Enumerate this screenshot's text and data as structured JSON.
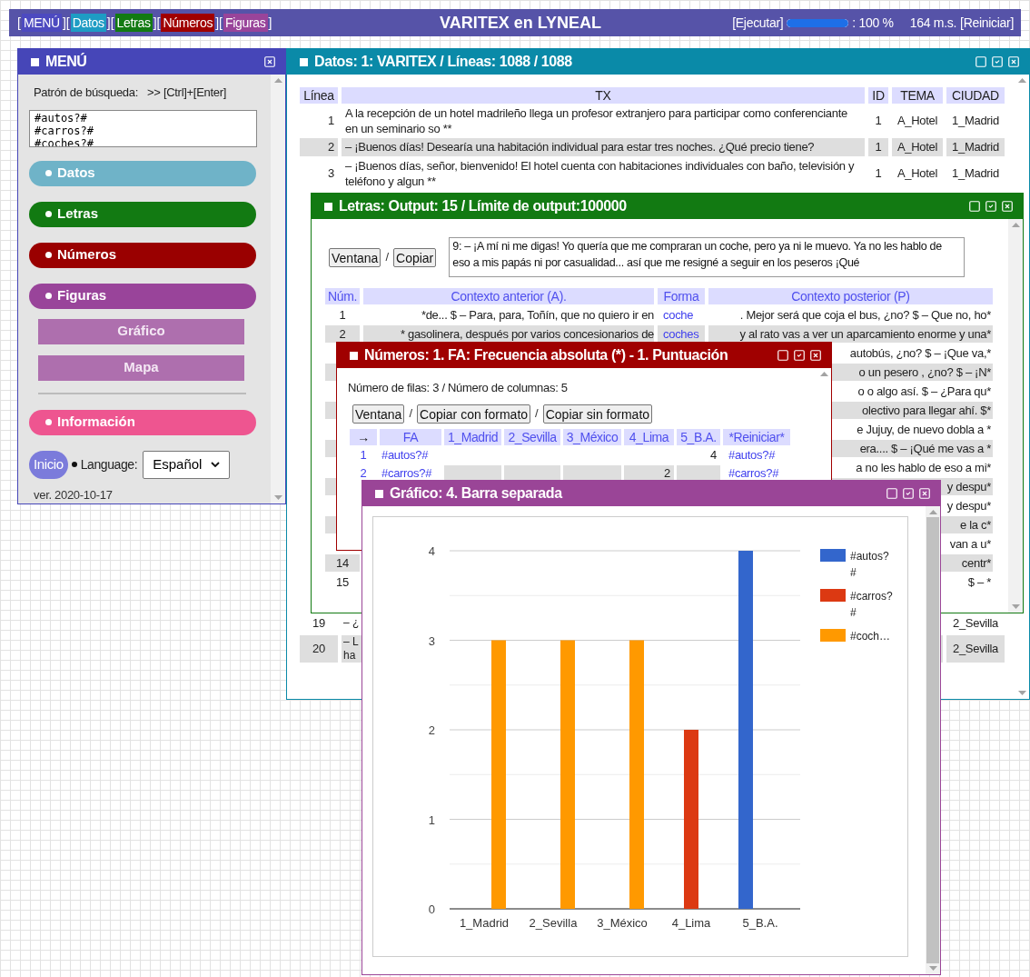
{
  "top_bar": {
    "nav": [
      {
        "kind": "bracket",
        "text": "["
      },
      {
        "kind": "tab",
        "text": "MENÚ",
        "color": "#4d4ac0"
      },
      {
        "kind": "bracket",
        "text": "]["
      },
      {
        "kind": "tab",
        "text": "Datos",
        "color": "#1e9cc4"
      },
      {
        "kind": "bracket",
        "text": "]["
      },
      {
        "kind": "tab",
        "text": "Letras",
        "color": "#127a12"
      },
      {
        "kind": "bracket",
        "text": "]["
      },
      {
        "kind": "tab",
        "text": "Números",
        "color": "#a00000"
      },
      {
        "kind": "bracket",
        "text": "]["
      },
      {
        "kind": "tab",
        "text": "Figuras",
        "color": "#99449a"
      },
      {
        "kind": "bracket",
        "text": "]"
      }
    ],
    "title": "VARITEX en LYNEAL",
    "run_link": "[Ejecutar]",
    "progress": {
      "level": 1,
      "reading": ": 100 %"
    },
    "time": "164 m.s.",
    "reset_link": "[Reiniciar]"
  },
  "menu": {
    "title": "MENÚ",
    "search_label": "Patrón de búsqueda:",
    "shortcut": ">> [Ctrl]+[Enter]",
    "pattern": "#autos?#\n#carros?#\n#coches?#",
    "sections": [
      {
        "label": "Datos",
        "color": "#6fb3c8"
      },
      {
        "label": "Letras",
        "color": "#127a12"
      },
      {
        "label": "Números",
        "color": "#9a0000"
      },
      {
        "label": "Figuras",
        "color": "#99449a",
        "children": [
          "Gráfico",
          "Mapa"
        ]
      },
      {
        "label": "Información",
        "color": "#ee5590"
      }
    ],
    "home_button": "Inicio",
    "language_label": "Language:",
    "language": "Español",
    "version": "ver. 2020-10-17"
  },
  "datos": {
    "title": "Datos: 1: VARITEX / Líneas: 1088 / 1088",
    "columns": [
      "Línea",
      "TX",
      "ID",
      "TEMA",
      "CIUDAD"
    ],
    "rows": [
      {
        "linea": "1",
        "tx": "A la recepción de un hotel madrileño llega un profesor extranjero para participar como conferenciante en un seminario so **",
        "id": "1",
        "tema": "A_Hotel",
        "ciudad": "1_Madrid"
      },
      {
        "linea": "2",
        "tx": "– ¡Buenos días! Desearía una habitación individual para estar tres noches. ¿Qué precio tiene?",
        "id": "1",
        "tema": "A_Hotel",
        "ciudad": "1_Madrid"
      },
      {
        "linea": "3",
        "tx": "– ¡Buenos días, señor, bienvenido! El hotel cuenta con habitaciones individuales con baño, televisión y teléfono y algun **",
        "id": "1",
        "tema": "A_Hotel",
        "ciudad": "1_Madrid"
      }
    ],
    "lower_rows": [
      {
        "linea": "19",
        "tx": "– ¿",
        "ciudad": "2_Sevilla"
      },
      {
        "linea": "20",
        "tx": "– L ha",
        "ciudad": "2_Sevilla"
      }
    ]
  },
  "letras": {
    "title": "Letras: Output: 15 / Límite de output:100000",
    "actions": [
      {
        "kind": "button",
        "text": "Ventana"
      },
      {
        "kind": "separator",
        "text": "/"
      },
      {
        "kind": "button",
        "text": "Copiar"
      }
    ],
    "text": "9: – ¡A mí ni me digas! Yo quería que me compraran un coche, pero ya ni le muevo. Ya no les hablo de eso a mis papás ni por casualidad... así que me resigné a seguir en los peseros ¡Qué",
    "columns": [
      "Núm.",
      "Contexto anterior (A).",
      "Forma",
      "Contexto posterior (P)"
    ],
    "rows": [
      {
        "num": "1",
        "before": "*de... $ – Para, para, Toñín, que no quiero ir en",
        "form": "coche",
        "after": ". Mejor será que coja el bus, ¿no? $ – Que no, ho*"
      },
      {
        "num": "2",
        "before": "* gasolinera, después por varios concesionarios de",
        "form": "coches",
        "after": "y al rato vas a ver un aparcamiento enorme y una*"
      },
      {
        "after": "autobús, ¿no? $ – ¡Que va,*"
      },
      {
        "after": "o un pesero , ¿no? $ – ¡N*"
      },
      {
        "after": "o o algo así. $ – ¿Para qu*"
      },
      {
        "after": "olectivo para llegar ahí. $*"
      },
      {
        "after": "e Jujuy, de nuevo dobla a *"
      },
      {
        "after": "era.... $ – ¡Qué me vas a *"
      },
      {
        "after": "a no les hablo de eso a mi*"
      },
      {
        "after": "y despu*"
      },
      {
        "after": "y despu*"
      },
      {
        "after": "e la c*"
      },
      {
        "after": "van a u*"
      },
      {
        "num": "14",
        "after": "centr*"
      },
      {
        "num": "15",
        "after": "$ – *"
      }
    ]
  },
  "numeros": {
    "title": "Números: 1. FA: Frecuencia absoluta (*) - 1. Puntuación",
    "summary": "Número de filas: 3 / Número de columnas: 5",
    "actions": [
      {
        "kind": "button",
        "text": "Ventana"
      },
      {
        "kind": "separator",
        "text": "/"
      },
      {
        "kind": "button",
        "text": "Copiar con formato"
      },
      {
        "kind": "separator",
        "text": "/"
      },
      {
        "kind": "button",
        "text": "Copiar sin formato"
      }
    ],
    "columns": [
      "→",
      "FA",
      "1_Madrid",
      "2_Sevilla",
      "3_México",
      "4_Lima",
      "5_B.A.",
      "*Reiniciar*"
    ],
    "rows": [
      {
        "num": "1",
        "label": "#autos?#",
        "counts": [
          {
            "kind": "gap"
          },
          {
            "kind": "gap"
          },
          {
            "kind": "gap"
          },
          {
            "kind": "gap"
          },
          {
            "kind": "value",
            "text": "4"
          }
        ],
        "tail": "#autos?#"
      },
      {
        "num": "2",
        "label": "#carros?#",
        "counts": [
          {
            "kind": "gap"
          },
          {
            "kind": "gap"
          },
          {
            "kind": "gap"
          },
          {
            "kind": "value",
            "text": "2"
          },
          {
            "kind": "gap"
          }
        ],
        "tail": "#carros?#"
      }
    ]
  },
  "grafico": {
    "title": "Gráfico: 4. Barra separada",
    "chart_data": {
      "type": "bar",
      "categories": [
        "1_Madrid",
        "2_Sevilla",
        "3_México",
        "4_Lima",
        "5_B.A."
      ],
      "series": [
        {
          "name": "#autos?#",
          "color": "#3366cc",
          "values": [
            0,
            0,
            0,
            0,
            4
          ]
        },
        {
          "name": "#carros?#",
          "color": "#dc3912",
          "values": [
            0,
            0,
            0,
            2,
            0
          ]
        },
        {
          "name": "#coch…",
          "color": "#ff9900",
          "values": [
            3,
            3,
            3,
            0,
            0
          ]
        }
      ],
      "ylim": [
        0,
        4
      ],
      "yticks": [
        0,
        1,
        2,
        3,
        4
      ],
      "grid": true,
      "legend": "right"
    }
  }
}
